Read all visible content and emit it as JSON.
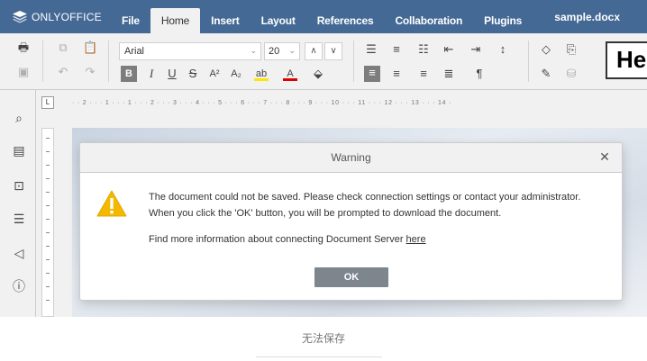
{
  "app": {
    "brand": "ONLYOFFICE",
    "document_name": "sample.docx"
  },
  "tabs": [
    {
      "label": "File"
    },
    {
      "label": "Home"
    },
    {
      "label": "Insert"
    },
    {
      "label": "Layout"
    },
    {
      "label": "References"
    },
    {
      "label": "Collaboration"
    },
    {
      "label": "Plugins"
    }
  ],
  "toolbar": {
    "font_name": "Arial",
    "font_size": "20",
    "bold_label": "B",
    "style_preview": "He"
  },
  "ruler": {
    "horizontal_marks": "· · 2 · · · 1 · · · 1 · · · 2 · · · 3 · · · 4 · · · 5 · · · 6 · · · 7 · · · 8 · · · 9 · · · 10 · · · 11 · · · 12 · · · 13 · · · 14 ·",
    "corner_label": "L"
  },
  "dialog": {
    "title": "Warning",
    "message_line1": "The document could not be saved. Please check connection settings or contact your administrator.",
    "message_line2": "When you click the 'OK' button, you will be prompted to download the document.",
    "info_text": "Find more information about connecting Document Server ",
    "link_text": "here",
    "ok_label": "OK"
  },
  "caption": "无法保存",
  "colors": {
    "header_bg": "#446995",
    "warning_yellow": "#f5b800"
  }
}
